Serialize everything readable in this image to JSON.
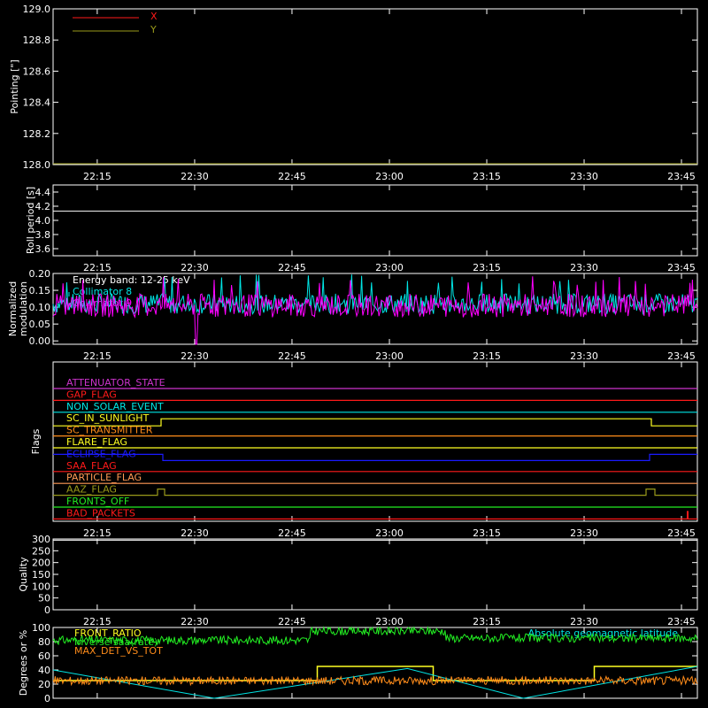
{
  "time_ticks": [
    "22:15",
    "22:30",
    "22:45",
    "23:00",
    "23:15",
    "23:30",
    "23:45"
  ],
  "colors": {
    "background": "#000000",
    "axes": "#ffffff",
    "red": "#ff1a1a",
    "olive": "#9a9a1a",
    "white": "#ffffff",
    "cyan": "#00e5e5",
    "magenta": "#ff00ff",
    "green": "#22ee22",
    "orange": "#ff8c1a",
    "yellow": "#ffff22",
    "blue": "#1a1aff",
    "purple": "#cc33cc",
    "light_orange": "#ff9955"
  },
  "chart_data": [
    {
      "id": "pointing",
      "type": "line",
      "ylabel": "Pointing [\"]",
      "ylim": [
        128.0,
        129.0
      ],
      "yticks": [
        "128.0",
        "128.2",
        "128.4",
        "128.6",
        "128.8",
        "129.0"
      ],
      "legend": [
        "X",
        "Y"
      ],
      "series": [
        {
          "name": "X",
          "values": []
        },
        {
          "name": "Y",
          "values": [
            128.0,
            128.0
          ]
        }
      ]
    },
    {
      "id": "roll_period",
      "type": "line",
      "ylabel": "Roll period [s]",
      "ylim": [
        3.5,
        4.5
      ],
      "yticks": [
        "3.6",
        "3.8",
        "4.0",
        "4.2",
        "4.4"
      ],
      "series": [
        {
          "values": [
            4.13,
            4.13
          ]
        }
      ]
    },
    {
      "id": "modulation",
      "type": "line",
      "ylabel": [
        "Normalized",
        "modulation"
      ],
      "ylim": [
        -0.01,
        0.2
      ],
      "yticks": [
        "0.00",
        "0.05",
        "0.10",
        "0.15",
        "0.20"
      ],
      "annotation": "Energy band: 12-25 keV",
      "legend": [
        "Collimator 8",
        "Collimator 9"
      ],
      "series": [
        {
          "name": "Collimator 8",
          "mean": 0.11,
          "spread": 0.03
        },
        {
          "name": "Collimator 9",
          "mean": 0.105,
          "spread": 0.035
        }
      ]
    },
    {
      "id": "flags",
      "type": "line",
      "ylabel": "Flags",
      "flags": [
        {
          "name": "ATTENUATOR_STATE",
          "color": "#cc33cc"
        },
        {
          "name": "GAP_FLAG",
          "color": "#ff1a1a"
        },
        {
          "name": "NON_SOLAR_EVENT",
          "color": "#00e5e5"
        },
        {
          "name": "SC_IN_SUNLIGHT",
          "color": "#ffff22"
        },
        {
          "name": "SC_TRANSMITTER",
          "color": "#ff8c1a"
        },
        {
          "name": "FLARE_FLAG",
          "color": "#ffff22"
        },
        {
          "name": "ECLIPSE_FLAG",
          "color": "#1a1aff"
        },
        {
          "name": "SAA_FLAG",
          "color": "#ff1a1a"
        },
        {
          "name": "PARTICLE_FLAG",
          "color": "#ff9955"
        },
        {
          "name": "AAZ_FLAG",
          "color": "#9a9a1a"
        },
        {
          "name": "FRONTS_OFF",
          "color": "#22ee22"
        },
        {
          "name": "BAD_PACKETS",
          "color": "#ff1a1a"
        }
      ]
    },
    {
      "id": "quality",
      "type": "line",
      "ylabel": "Quality",
      "ylim": [
        0,
        300
      ],
      "yticks": [
        "0",
        "50",
        "100",
        "150",
        "200",
        "250",
        "300"
      ],
      "series": [
        {
          "values": []
        }
      ]
    },
    {
      "id": "front_ratio",
      "type": "line",
      "ylabel": "Degrees or %",
      "ylim": [
        0,
        100
      ],
      "yticks": [
        "0",
        "20",
        "40",
        "60",
        "80",
        "100"
      ],
      "legend": [
        "FRONT_RATIO",
        "Inverse saa(rate)",
        "MAX_DET_VS_TOT",
        "Absolute geomagnetic latitude"
      ],
      "series": [
        {
          "name": "FRONT_RATIO",
          "levels": [
            [
              0.0,
              82
            ],
            [
              0.4,
              85
            ],
            [
              0.4,
              95
            ],
            [
              0.61,
              95
            ],
            [
              0.61,
              85
            ],
            [
              1.0,
              82
            ]
          ]
        },
        {
          "name": "Inverse saa(rate)",
          "levels": [
            [
              0.0,
              25
            ],
            [
              0.41,
              25
            ],
            [
              0.41,
              45
            ],
            [
              0.59,
              45
            ],
            [
              0.59,
              25
            ],
            [
              0.84,
              25
            ],
            [
              0.84,
              45
            ],
            [
              1.0,
              45
            ]
          ]
        },
        {
          "name": "MAX_DET_VS_TOT",
          "mean": 25,
          "spread": 6
        },
        {
          "name": "Absolute geomagnetic latitude",
          "zigzag": [
            [
              0.0,
              40
            ],
            [
              0.25,
              0
            ],
            [
              0.55,
              42
            ],
            [
              0.73,
              0
            ],
            [
              1.0,
              45
            ]
          ]
        }
      ]
    }
  ]
}
